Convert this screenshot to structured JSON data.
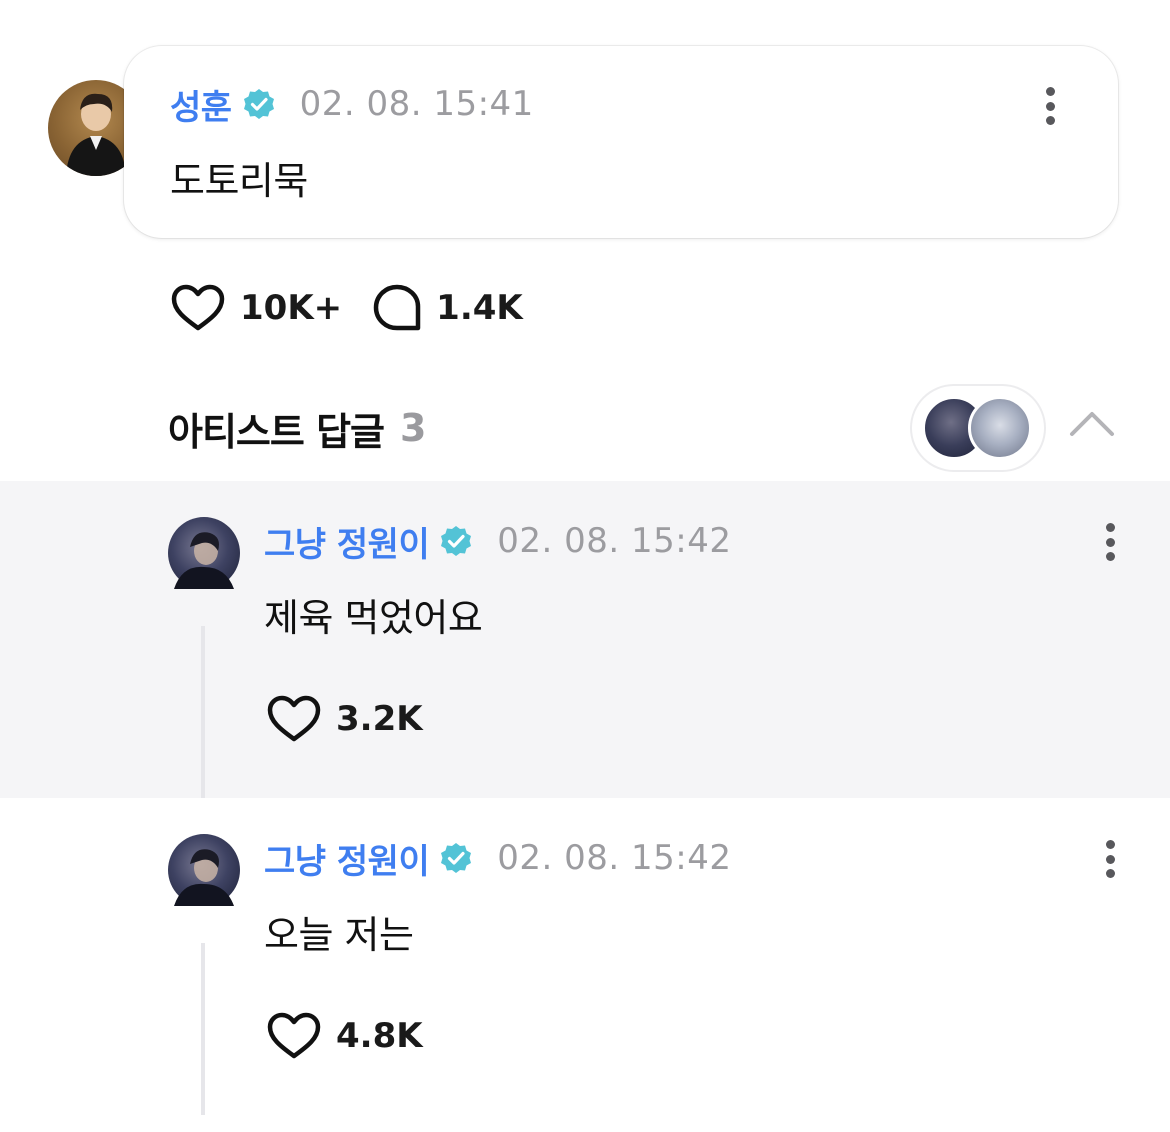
{
  "post": {
    "author": "성훈",
    "timestamp": "02. 08. 15:41",
    "body": "도토리묵",
    "likes": "10K+",
    "comments": "1.4K"
  },
  "artist_replies": {
    "title": "아티스트 답글",
    "count": "3",
    "items": [
      {
        "author": "그냥 정원이",
        "timestamp": "02. 08. 15:42",
        "body": "제육 먹었어요",
        "likes": "3.2K"
      },
      {
        "author": "그냥 정원이",
        "timestamp": "02. 08. 15:42",
        "body": "오늘 저는",
        "likes": "4.8K"
      }
    ]
  },
  "colors": {
    "author_blue": "#3f7ef0",
    "verified_teal": "#53c3d6",
    "timestamp_gray": "#9c9ca0",
    "highlight_bg": "#f5f5f7"
  },
  "icons": [
    "verified-badge-icon",
    "more-vertical-icon",
    "heart-icon",
    "comment-bubble-icon",
    "chevron-up-icon"
  ]
}
